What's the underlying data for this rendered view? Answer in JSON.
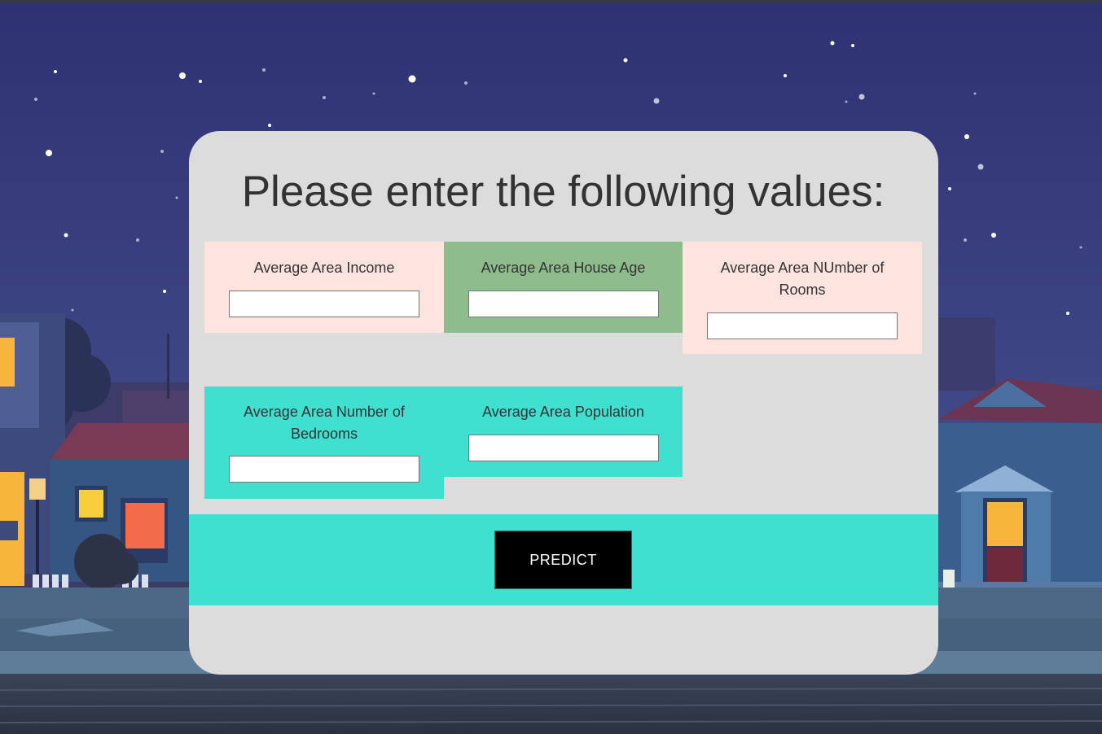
{
  "form": {
    "title": "Please enter the following values:",
    "fields": [
      {
        "label": "Average Area Income",
        "value": ""
      },
      {
        "label": "Average Area House Age",
        "value": ""
      },
      {
        "label": "Average Area NUmber of Rooms",
        "value": ""
      },
      {
        "label": "Average Area Number of Bedrooms",
        "value": ""
      },
      {
        "label": "Average Area Population",
        "value": ""
      }
    ],
    "submit_label": "PREDICT"
  },
  "colors": {
    "card_bg": "#dcdcdc",
    "field_pink": "#ffe3df",
    "field_green": "#8fbc8c",
    "field_turquoise": "#40e0d0",
    "button_bg": "#000000",
    "sky_top": "#2e3172",
    "sky_bottom": "#4a5596"
  },
  "background": {
    "scene": "night-street-illustration"
  }
}
